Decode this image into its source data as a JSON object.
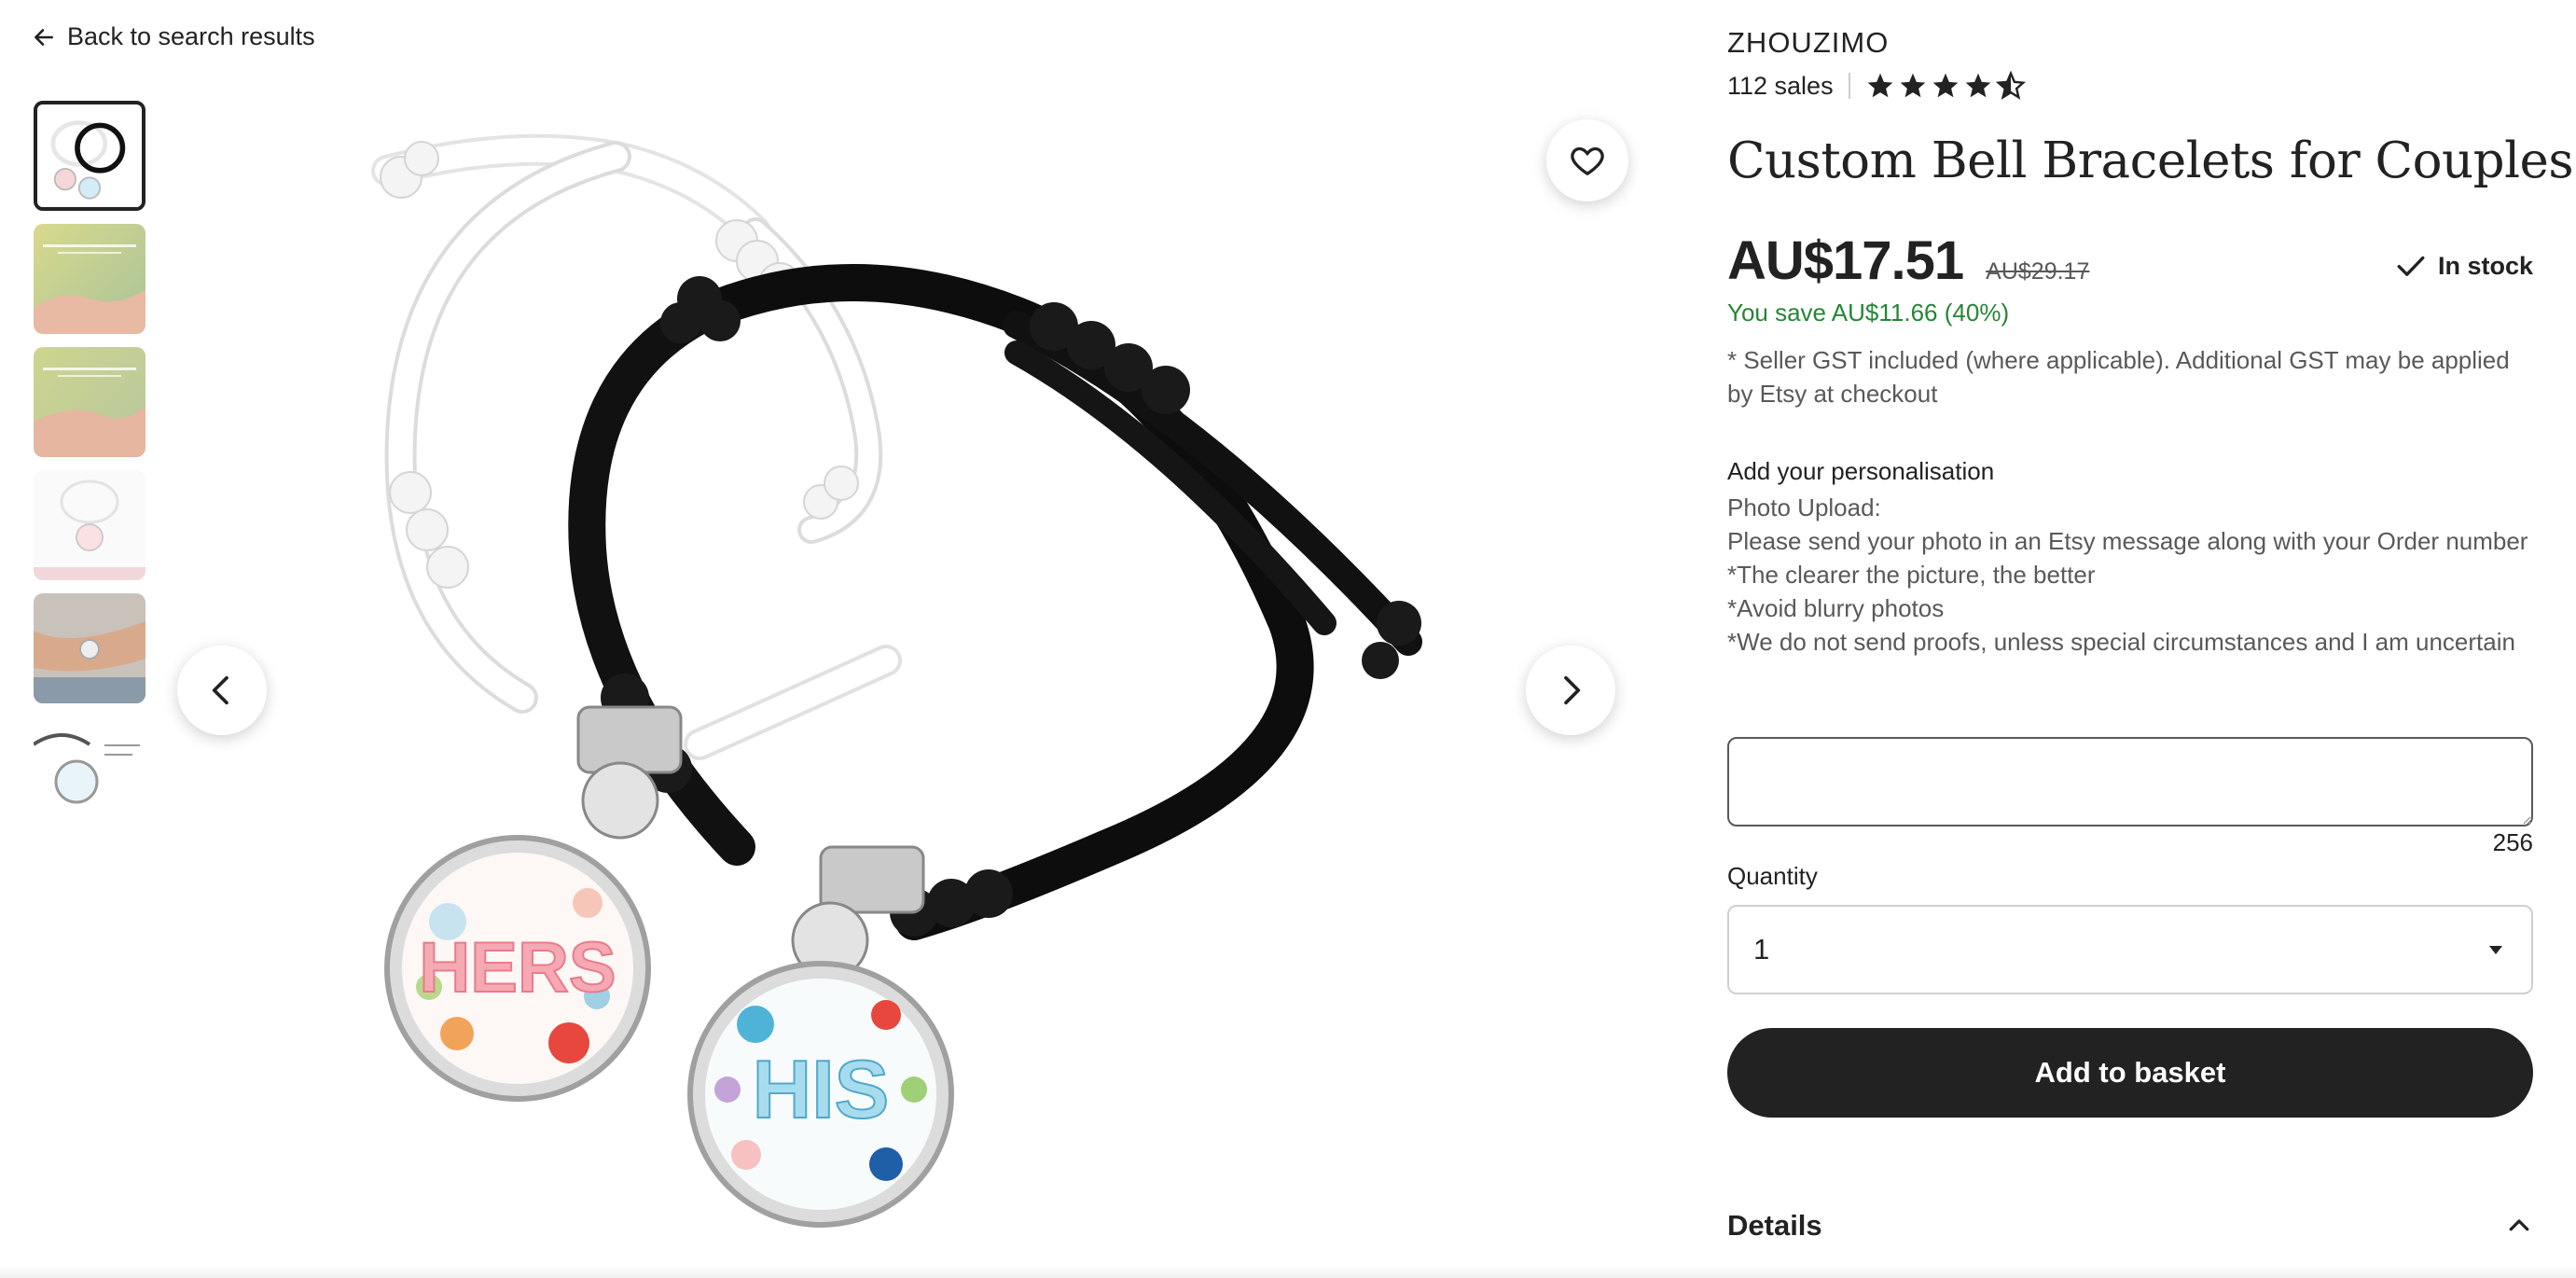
{
  "nav": {
    "back_label": "Back to search results"
  },
  "gallery": {
    "thumbnails": [
      {
        "name": "thumb-1",
        "active": true
      },
      {
        "name": "thumb-2",
        "active": false
      },
      {
        "name": "thumb-3",
        "active": false
      },
      {
        "name": "thumb-4",
        "active": false
      },
      {
        "name": "thumb-5",
        "active": false
      },
      {
        "name": "thumb-6",
        "active": false
      }
    ],
    "charm_text_left": "HERS",
    "charm_text_right": "HIS"
  },
  "product": {
    "shop_name": "ZHOUZIMO",
    "sales": "112 sales",
    "rating": 4.5,
    "title": "Custom Bell Bracelets for Couples",
    "price": "AU$17.51",
    "original_price": "AU$29.17",
    "stock_status": "In stock",
    "savings": "You save AU$11.66 (40%)",
    "gst_note": "* Seller GST included (where applicable). Additional GST may be applied by Etsy at checkout"
  },
  "personalisation": {
    "label": "Add your personalisation",
    "instructions": "Photo Upload:\nPlease send your photo in an Etsy message along with your Order number\n*The clearer the picture, the better\n*Avoid blurry photos\n*We do not send proofs, unless special circumstances and I am uncertain",
    "value": "",
    "char_remaining": "256"
  },
  "quantity": {
    "label": "Quantity",
    "selected": "1"
  },
  "actions": {
    "add_to_basket": "Add to basket"
  },
  "details": {
    "label": "Details"
  },
  "colors": {
    "success_green": "#258635",
    "primary_dark": "#222222"
  }
}
